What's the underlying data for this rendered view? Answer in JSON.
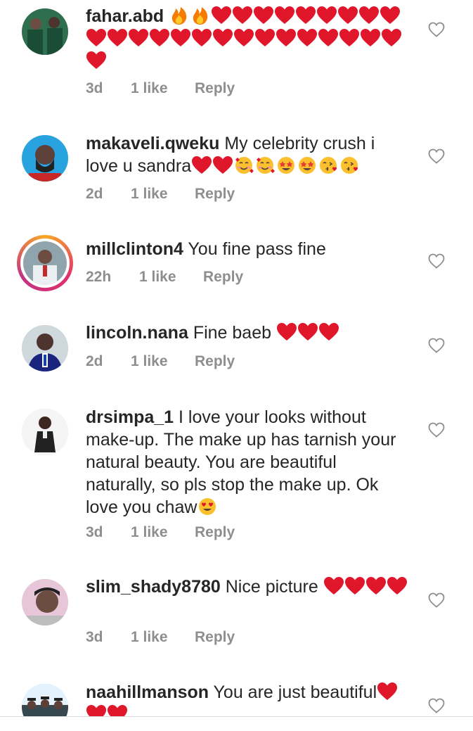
{
  "comments": [
    {
      "username": "fahar.abd",
      "text": "",
      "emoji": "🔥🔥❤❤❤❤❤❤❤❤❤❤❤❤❤❤❤❤❤❤❤❤❤❤❤❤❤",
      "time": "3d",
      "likes": "1 like",
      "reply": "Reply"
    },
    {
      "username": "makaveli.qweku",
      "text": "My celebrity crush i love u sandra",
      "emoji": "❤❤🥰🥰🤩🤩😘😘",
      "time": "2d",
      "likes": "1 like",
      "reply": "Reply"
    },
    {
      "username": "millclinton4",
      "text": "You fine pass fine",
      "emoji": "",
      "time": "22h",
      "likes": "1 like",
      "reply": "Reply"
    },
    {
      "username": "lincoln.nana",
      "text": "Fine baeb",
      "emoji": "❤❤❤",
      "time": "2d",
      "likes": "1 like",
      "reply": "Reply"
    },
    {
      "username": "drsimpa_1",
      "text": "I love your looks without make-up. The make up has tarnish your natural beauty. You are beautiful naturally, so pls stop the make up. Ok love you chaw",
      "emoji": "😍",
      "time": "3d",
      "likes": "1 like",
      "reply": "Reply"
    },
    {
      "username": "slim_shady8780",
      "text": "Nice picture",
      "emoji": "❤❤❤❤",
      "time": "3d",
      "likes": "1 like",
      "reply": "Reply"
    },
    {
      "username": "naahillmanson",
      "text": "You are just beautiful",
      "emoji": "❤❤❤",
      "time": "",
      "likes": "",
      "reply": ""
    }
  ],
  "colors": {
    "heart": "#e0162b",
    "meta": "#8e8e8e",
    "text": "#262626"
  }
}
